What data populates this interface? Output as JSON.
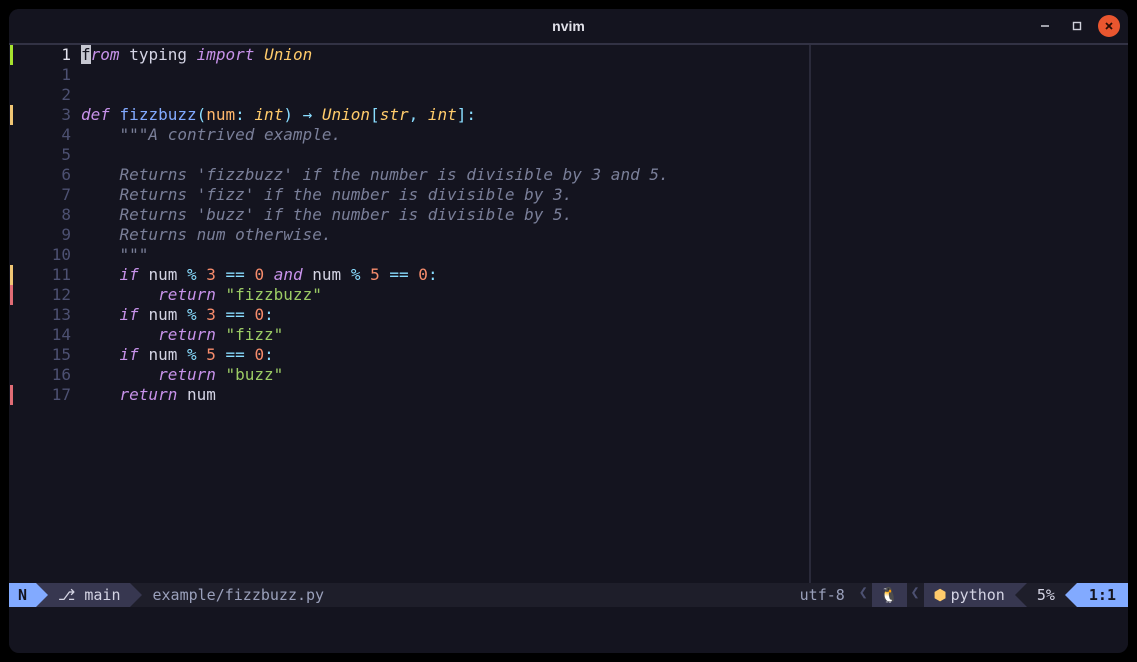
{
  "window": {
    "title": "nvim"
  },
  "gutter": {
    "current": "1",
    "rel": [
      "1",
      "2",
      "3",
      "4",
      "5",
      "6",
      "7",
      "8",
      "9",
      "10",
      "11",
      "12",
      "13",
      "14",
      "15",
      "16",
      "17"
    ]
  },
  "signs": {
    "1": "#a6e22e",
    "3": "#f0c674",
    "11": "#f0c674",
    "12": "#e06c75",
    "17": "#e06c75"
  },
  "code": {
    "l1": {
      "from": "f",
      "rom": "rom",
      "typing": "typing",
      "import": "import",
      "Union": "Union"
    },
    "l4": {
      "def": "def",
      "fn": "fizzbuzz",
      "lp": "(",
      "num": "num",
      "colon1": ": ",
      "int": "int",
      "rp": ")",
      "arrow": " → ",
      "Union": "Union",
      "lb": "[",
      "str": "str",
      "comma": ", ",
      "int2": "int",
      "rb": "]",
      "end": ":"
    },
    "l5": {
      "t": "    \"\"\"A contrived example."
    },
    "l6": {
      "t": ""
    },
    "l7": {
      "t": "    Returns 'fizzbuzz' if the number is divisible by 3 and 5."
    },
    "l8": {
      "t": "    Returns 'fizz' if the number is divisible by 3."
    },
    "l9": {
      "t": "    Returns 'buzz' if the number is divisible by 5."
    },
    "l10": {
      "t": "    Returns num otherwise."
    },
    "l11": {
      "t": "    \"\"\""
    },
    "l12": {
      "if": "if",
      "num": "num",
      "pct": "%",
      "n3": "3",
      "eq": "==",
      "z": "0",
      "and": "and",
      "num2": "num",
      "pct2": "%",
      "n5": "5",
      "eq2": "==",
      "z2": "0",
      "end": ":"
    },
    "l13": {
      "return": "return",
      "s": "\"fizzbuzz\""
    },
    "l14": {
      "if": "if",
      "num": "num",
      "pct": "%",
      "n": "3",
      "eq": "==",
      "z": "0",
      "end": ":"
    },
    "l15": {
      "return": "return",
      "s": "\"fizz\""
    },
    "l16": {
      "if": "if",
      "num": "num",
      "pct": "%",
      "n": "5",
      "eq": "==",
      "z": "0",
      "end": ":"
    },
    "l17": {
      "return": "return",
      "s": "\"buzz\""
    },
    "l18": {
      "return": "return",
      "num": "num"
    }
  },
  "status": {
    "mode": "N",
    "branch_icon": "⎇",
    "branch": "main",
    "file": "example/fizzbuzz.py",
    "encoding": "utf-8",
    "os_icon": "🐧",
    "python_icon": "⬢",
    "filetype": "python",
    "percent": "5%",
    "position": "1:1"
  }
}
